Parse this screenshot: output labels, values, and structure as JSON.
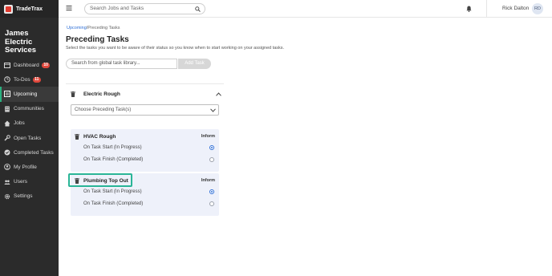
{
  "brand": {
    "name": "TradeTrax"
  },
  "company": {
    "name": "James\nElectric\nServices"
  },
  "sidebar": {
    "items": [
      {
        "label": "Dashboard",
        "icon": "calendar-icon",
        "badge": "10",
        "active": false
      },
      {
        "label": "To-Dos",
        "icon": "todo-icon",
        "badge": "11",
        "active": false
      },
      {
        "label": "Upcoming",
        "icon": "upcoming-icon",
        "badge": "",
        "active": true
      },
      {
        "label": "Communities",
        "icon": "building-icon",
        "badge": "",
        "active": false
      },
      {
        "label": "Jobs",
        "icon": "home-icon",
        "badge": "",
        "active": false
      },
      {
        "label": "Open Tasks",
        "icon": "wrench-icon",
        "badge": "",
        "active": false
      },
      {
        "label": "Completed Tasks",
        "icon": "check-circle-icon",
        "badge": "",
        "active": false
      },
      {
        "label": "My Profile",
        "icon": "user-icon",
        "badge": "",
        "active": false
      },
      {
        "label": "Users",
        "icon": "users-icon",
        "badge": "",
        "active": false
      },
      {
        "label": "Settings",
        "icon": "gear-icon",
        "badge": "",
        "active": false
      }
    ]
  },
  "topbar": {
    "search_placeholder": "Search Jobs and Tasks",
    "user_name": "Rick Dalton",
    "avatar_initials": "RD"
  },
  "breadcrumb": {
    "link": "Upcoming",
    "separator": "/",
    "current": "Preceding Tasks"
  },
  "page": {
    "title": "Preceding Tasks",
    "subtitle": "Select the tasks you want to be aware of their status so you know when to start working on your assigned tasks."
  },
  "library": {
    "placeholder": "Search from global task library...",
    "add_label": "Add Task"
  },
  "task": {
    "title": "Electric Rough",
    "select_placeholder": "Choose Preceding Task(s)"
  },
  "preceding": [
    {
      "title": "HVAC Rough",
      "inform_label": "Inform",
      "option_start": "On Task Start (In Progress)",
      "option_finish": "On Task Finish (Completed)",
      "selected": "start"
    },
    {
      "title": "Plumbing Top Out",
      "inform_label": "Inform",
      "option_start": "On Task Start (In Progress)",
      "option_finish": "On Task Finish (Completed)",
      "selected": "start"
    }
  ],
  "colors": {
    "accent": "#2ab07f",
    "highlight": "#2ab597",
    "badge": "#e0483c",
    "link": "#2f6fd6",
    "card_bg": "#eef1fa",
    "sidebar_bg": "#2b2b2b"
  }
}
